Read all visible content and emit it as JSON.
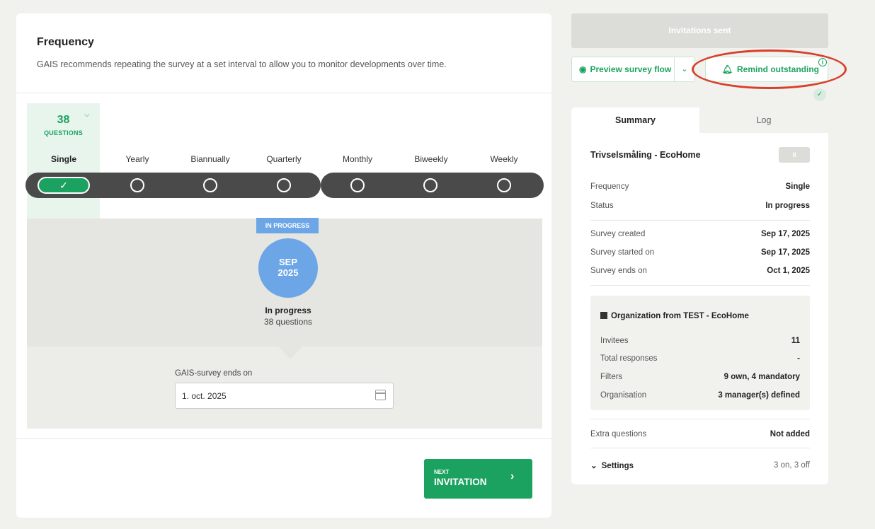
{
  "frequency": {
    "title": "Frequency",
    "description": "GAIS recommends repeating the survey at a set interval to allow you to monitor developments over time.",
    "question_count": "38",
    "question_label": "QUESTIONS",
    "options": [
      "Single",
      "Yearly",
      "Biannually",
      "Quarterly",
      "Monthly",
      "Biweekly",
      "Weekly"
    ],
    "selected": "Single"
  },
  "timeline": {
    "badge": "IN PROGRESS",
    "month": "SEP",
    "year": "2025",
    "status": "In progress",
    "questions": "38 questions"
  },
  "end_date": {
    "label": "GAIS-survey ends on",
    "value": "1. oct. 2025"
  },
  "next_button": {
    "small": "NEXT",
    "big": "INVITATION",
    "chevron": "›"
  },
  "actions": {
    "invitations_sent": "Invitations sent",
    "preview": "Preview survey flow",
    "remind": "Remind outstanding",
    "info": "i",
    "check": "✓"
  },
  "tabs": [
    "Summary",
    "Log"
  ],
  "summary": {
    "title": "Trivselsmåling - EcoHome",
    "pause": "II",
    "rows1": [
      {
        "k": "Frequency",
        "v": "Single"
      },
      {
        "k": "Status",
        "v": "In progress"
      }
    ],
    "rows2": [
      {
        "k": "Survey created",
        "v": "Sep 17, 2025"
      },
      {
        "k": "Survey started on",
        "v": "Sep 17, 2025"
      },
      {
        "k": "Survey ends on",
        "v": "Oct 1, 2025"
      }
    ],
    "org": {
      "title": "Organization from TEST - EcoHome",
      "rows": [
        {
          "k": "Invitees",
          "v": "11"
        },
        {
          "k": "Total responses",
          "v": "-"
        },
        {
          "k": "Filters",
          "v": "9 own, 4 mandatory"
        },
        {
          "k": "Organisation",
          "v": "3 manager(s) defined"
        }
      ]
    },
    "extra": {
      "k": "Extra questions",
      "v": "Not added"
    },
    "settings": {
      "k": "Settings",
      "v": "3 on, 3 off"
    }
  },
  "colors": {
    "accent": "#1ca260",
    "timeline_blue": "#6ca6e6",
    "highlight_red": "#d8402b"
  }
}
